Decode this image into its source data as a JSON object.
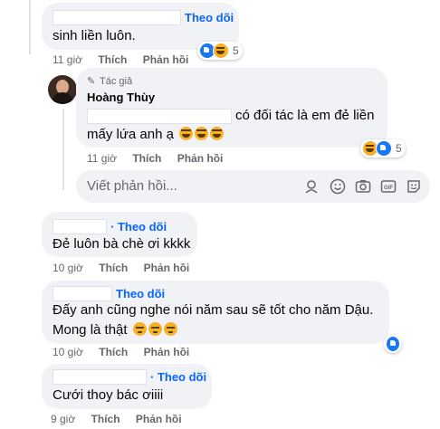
{
  "comments": [
    {
      "follow": "Theo dõi",
      "text": "sinh liền luôn.",
      "time": "11 giờ",
      "like": "Thích",
      "reply": "Phản hồi",
      "reactions": [
        "like-icon",
        "haha-icon"
      ],
      "count": "5"
    },
    {
      "author_badge": "Tác giả",
      "author": "Hoàng Thùy",
      "text_line1": "có đối tác là em đẻ liền",
      "text_line2": "mấy lứa anh ạ",
      "emojis": [
        "laugh",
        "laugh",
        "laugh"
      ],
      "time": "11 giờ",
      "like": "Thích",
      "reply": "Phản hồi",
      "reactions": [
        "haha-icon",
        "like-icon"
      ],
      "count": "5"
    },
    {
      "follow": "· Theo dõi",
      "text": "Đẻ luôn bà chè ơi kkkk",
      "time": "10 giờ",
      "like": "Thích",
      "reply": "Phản hồi"
    },
    {
      "follow": "Theo dõi",
      "text_line1": "Đấy anh cũng nghe nói năm sau sẽ tốt cho năm Dậu.",
      "text_line2": "Mong là thật",
      "emojis": [
        "pensive",
        "pensive",
        "pensive"
      ],
      "time": "10 giờ",
      "like": "Thích",
      "reply": "Phản hồi",
      "reactions": [
        "like-icon"
      ]
    },
    {
      "follow": "· Theo dõi",
      "text": "Cưới thoy bác ơiiii",
      "time": "9 giờ",
      "like": "Thích",
      "reply": "Phản hồi"
    }
  ],
  "reply_input": {
    "placeholder": "Viết phản hồi..."
  },
  "colors": {
    "accent": "#0866ff",
    "bubble": "#f0f2f5",
    "meta": "#65676b"
  }
}
